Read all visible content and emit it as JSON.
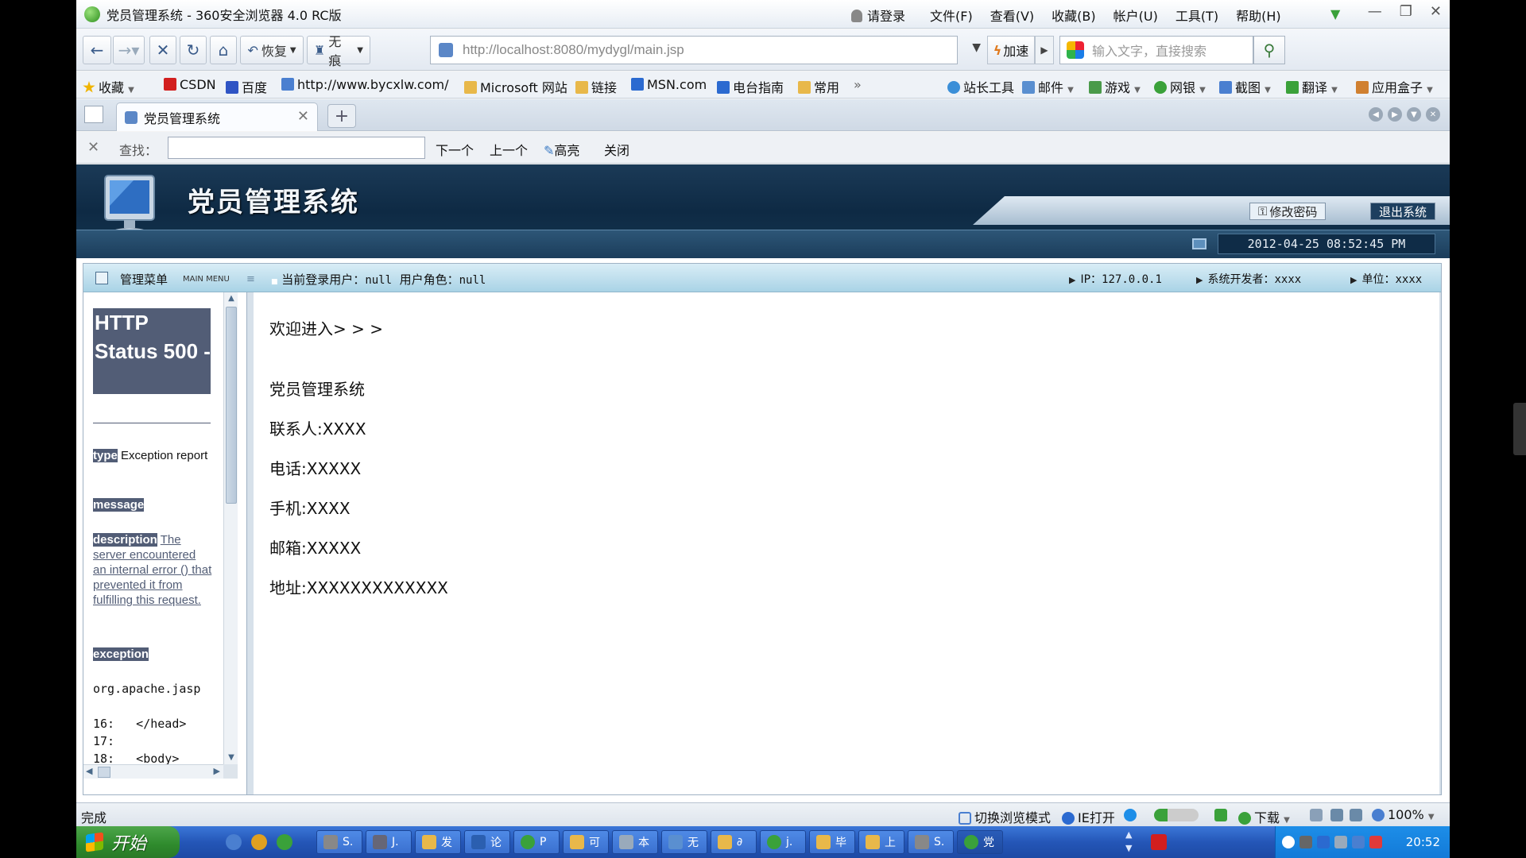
{
  "window": {
    "title": "党员管理系统 - 360安全浏览器 4.0 RC版",
    "login_label": "请登录",
    "menus": [
      "文件(F)",
      "查看(V)",
      "收藏(B)",
      "帐户(U)",
      "工具(T)",
      "帮助(H)"
    ]
  },
  "nav": {
    "restore_label": "恢复",
    "notrace_label": "无痕",
    "url": "http://localhost:8080/mydygl/main.jsp",
    "speed_label": "加速",
    "search_placeholder": "输入文字，直接搜索"
  },
  "favorites": [
    {
      "label": "收藏",
      "color": "#f0b400"
    },
    {
      "label": "CSDN",
      "color": "#d21f1f"
    },
    {
      "label": "百度",
      "color": "#2f54c4"
    },
    {
      "label": "http://www.bycxlw.com/",
      "color": "#4a7fd0"
    },
    {
      "label": "Microsoft 网站",
      "color": "#e8b84a"
    },
    {
      "label": "链接",
      "color": "#e8b84a"
    },
    {
      "label": "MSN.com",
      "color": "#2b6ad0"
    },
    {
      "label": "电台指南",
      "color": "#2b6ad0"
    },
    {
      "label": "常用",
      "color": "#e8b84a"
    }
  ],
  "favorites_more": "»",
  "tools_right": [
    {
      "label": "站长工具",
      "color": "#3b8fd8"
    },
    {
      "label": "邮件",
      "color": "#5a8fd0"
    },
    {
      "label": "游戏",
      "color": "#4a9a4a"
    },
    {
      "label": "网银",
      "color": "#3aa13a"
    },
    {
      "label": "截图",
      "color": "#4a7fd0"
    },
    {
      "label": "翻译",
      "color": "#3aa13a"
    },
    {
      "label": "应用盒子",
      "color": "#d08030"
    }
  ],
  "tab": {
    "title": "党员管理系统"
  },
  "find": {
    "label": "查找：",
    "next": "下一个",
    "prev": "上一个",
    "highlight": "高亮",
    "close": "关闭"
  },
  "site": {
    "title": "党员管理系统",
    "change_password": "修改密码",
    "logout": "退出系统",
    "datetime": "2012-04-25 08:52:45 PM",
    "menu_title": "管理菜单",
    "menu_sub": "MAIN MENU",
    "current_user_label": "当前登录用户：",
    "current_user": "null",
    "role_label": "用户角色：",
    "role": "null",
    "ip_label": "IP：",
    "ip": "127.0.0.1",
    "developer_label": "系统开发者：",
    "developer": "xxxx",
    "unit_label": "单位：",
    "unit": "xxxx"
  },
  "error": {
    "title": "HTTP Status 500 -",
    "type_label": "type",
    "type_text": "Exception report",
    "message_label": "message",
    "description_label": "description",
    "description_text": "The server encountered an internal error () that prevented it from fulfilling this request.",
    "exception_label": "exception",
    "code": [
      "org.apache.jasp",
      "",
      "16:   </head>",
      "17:",
      "18:   <body>"
    ]
  },
  "main": {
    "welcome": "欢迎进入> > >",
    "system_name": "党员管理系统",
    "contact": "联系人:XXXX",
    "phone": "电话:XXXXX",
    "mobile": "手机:XXXX",
    "email": "邮箱:XXXXX",
    "address": "地址:XXXXXXXXXXXXX"
  },
  "status": {
    "done": "完成",
    "switch_mode": "切换浏览模式",
    "ie_open": "IE打开",
    "download": "下载",
    "zoom": "100%"
  },
  "taskbar": {
    "start": "开始",
    "tasks": [
      "S.",
      "J.",
      "发",
      "论",
      "Р",
      "可",
      "本",
      "无",
      "∂",
      "j.",
      "毕",
      "上",
      "S.",
      "党"
    ],
    "clock": "20:52"
  }
}
